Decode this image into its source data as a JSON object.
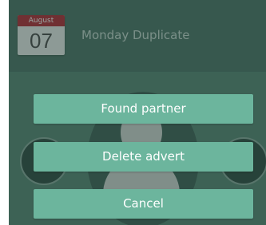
{
  "header": {
    "date_badge": {
      "month": "August",
      "day": "07"
    },
    "title": "Monday Duplicate"
  },
  "dialog": {
    "buttons": {
      "found_partner": "Found partner",
      "delete_advert": "Delete advert",
      "cancel": "Cancel"
    }
  },
  "colors": {
    "header_bg": "#4c7466",
    "content_bg": "#578674",
    "button_bg": "#6cb59d",
    "month_bar": "#b32b35"
  },
  "icons": {
    "avatar": "user-placeholder-icon",
    "left_nav": "chevron-left-icon",
    "right_nav": "chevron-right-icon"
  }
}
